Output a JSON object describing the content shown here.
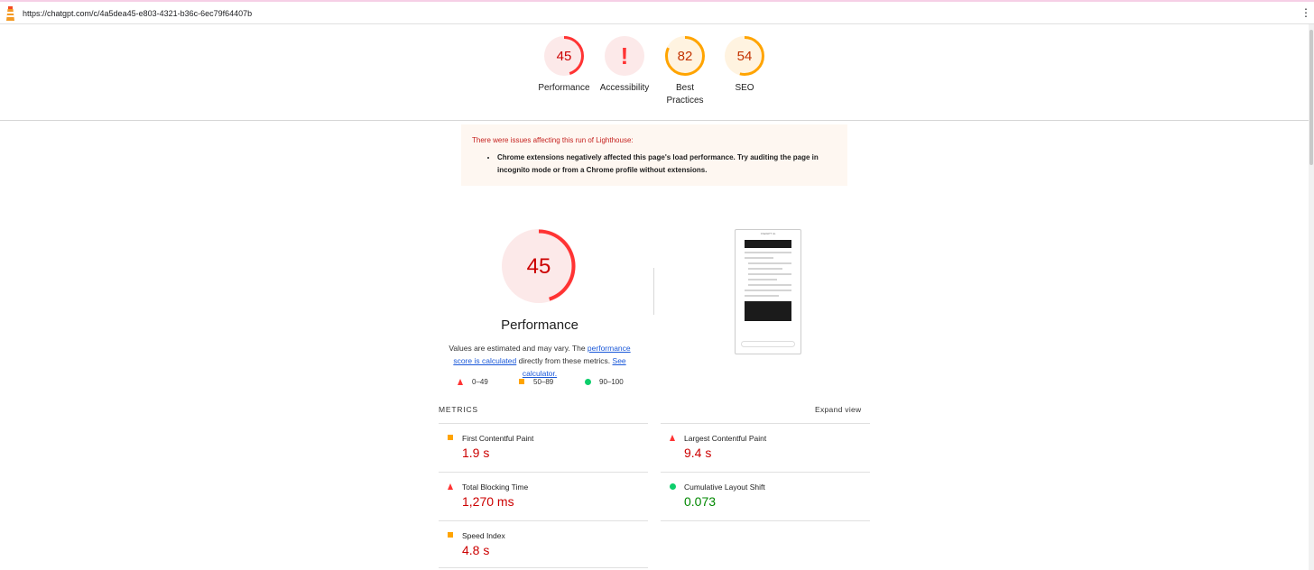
{
  "browser": {
    "url": "https://chatgpt.com/c/4a5dea45-e803-4321-b36c-6ec79f64407b",
    "menu_icon": "kebab-menu-icon"
  },
  "scores": [
    {
      "id": "performance",
      "value": "45",
      "fraction": 0.45,
      "label": "Performance",
      "color": "#ff3333",
      "bg": "#fce9e9",
      "text": "#c00"
    },
    {
      "id": "accessibility",
      "value": "!",
      "fraction": 0,
      "label": "Accessibility",
      "color": "#ff3333",
      "bg": "#fce9e9",
      "text": "#ff3333"
    },
    {
      "id": "best-practices",
      "value": "82",
      "fraction": 0.82,
      "label": "Best Practices",
      "color": "#ffa400",
      "bg": "#fff3e0",
      "text": "#c33300"
    },
    {
      "id": "seo",
      "value": "54",
      "fraction": 0.54,
      "label": "SEO",
      "color": "#ffa400",
      "bg": "#fff3e0",
      "text": "#c33300"
    }
  ],
  "warning": {
    "title": "There were issues affecting this run of Lighthouse:",
    "items": [
      "Chrome extensions negatively affected this page's load performance. Try auditing the page in incognito mode or from a Chrome profile without extensions."
    ]
  },
  "performance": {
    "score": "45",
    "fraction": 0.45,
    "title": "Performance",
    "desc_before": "Values are estimated and may vary. The ",
    "link_score": "performance score is calculated",
    "desc_middle": " directly from these metrics. ",
    "link_calc": "See calculator.",
    "legend": [
      {
        "shape": "triangle",
        "range": "0–49"
      },
      {
        "shape": "square",
        "range": "50–89"
      },
      {
        "shape": "circle",
        "range": "90–100"
      }
    ]
  },
  "metrics": {
    "header": "METRICS",
    "expand": "Expand view",
    "items": [
      {
        "name": "First Contentful Paint",
        "value": "1.9 s",
        "rating": "average"
      },
      {
        "name": "Largest Contentful Paint",
        "value": "9.4 s",
        "rating": "fail"
      },
      {
        "name": "Total Blocking Time",
        "value": "1,270 ms",
        "rating": "fail"
      },
      {
        "name": "Cumulative Layout Shift",
        "value": "0.073",
        "rating": "pass"
      },
      {
        "name": "Speed Index",
        "value": "4.8 s",
        "rating": "average"
      }
    ]
  },
  "screenshot": {
    "header": "ChatGPT 4o"
  }
}
